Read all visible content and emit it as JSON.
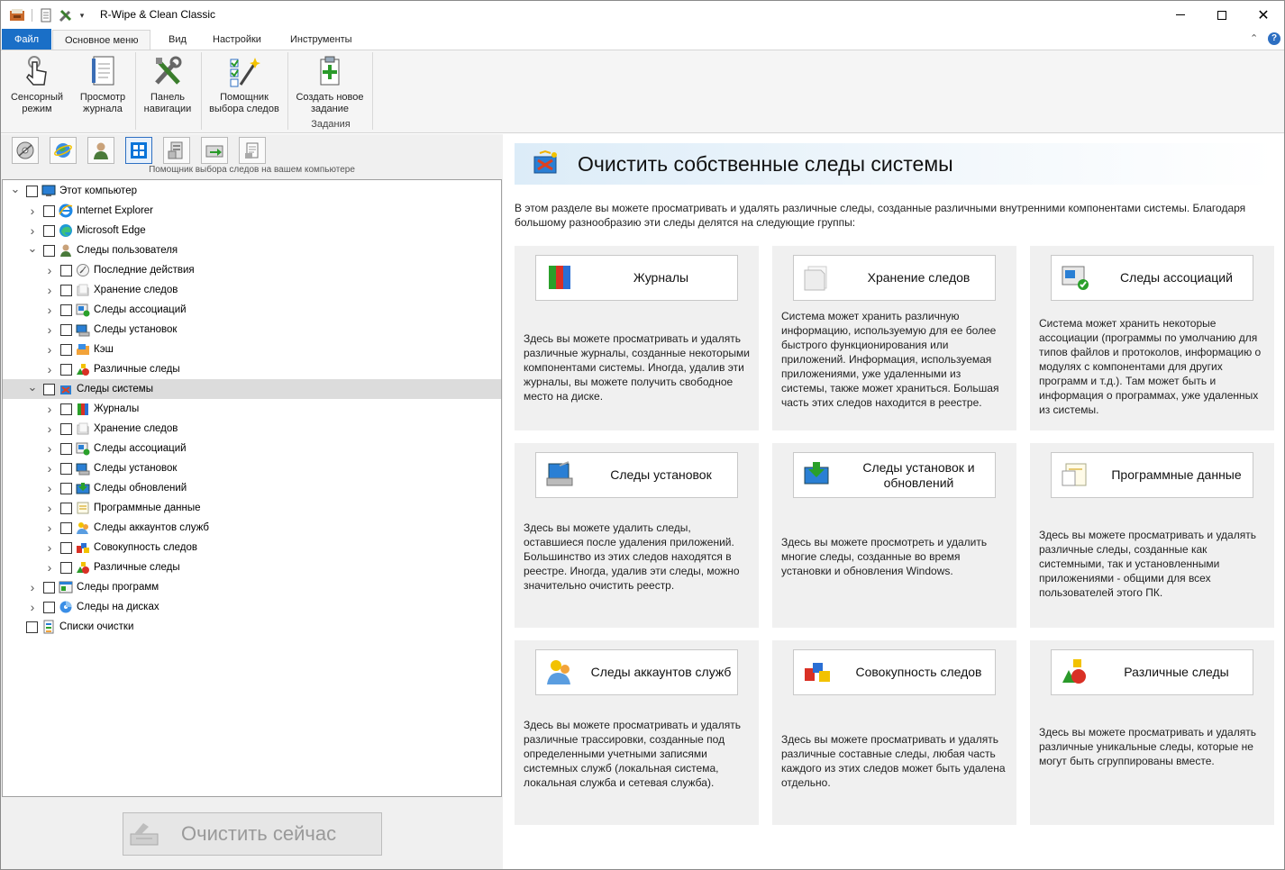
{
  "window": {
    "title": "R-Wipe & Clean Classic"
  },
  "ribbon": {
    "tabs": [
      "Файл",
      "Основное меню",
      "Вид",
      "Настройки",
      "Инструменты"
    ],
    "buttons": [
      {
        "line1": "Сенсорный",
        "line2": "режим",
        "icon": "touch-icon"
      },
      {
        "line1": "Просмотр",
        "line2": "журнала",
        "icon": "log-icon"
      },
      {
        "line1": "Панель",
        "line2": "навигации",
        "icon": "tools-icon"
      },
      {
        "line1": "Помощник",
        "line2": "выбора следов",
        "icon": "wizard-icon"
      },
      {
        "line1": "Создать новое",
        "line2": "задание",
        "icon": "new-task-icon"
      }
    ],
    "group_label": "Задания"
  },
  "toolbar": {
    "label": "Помощник выбора следов на вашем компьютере"
  },
  "tree": {
    "nodes": [
      {
        "label": "Этот компьютер",
        "level": 0,
        "expander": "open"
      },
      {
        "label": "Internet  Explorer",
        "level": 1,
        "expander": "closed"
      },
      {
        "label": "Microsoft Edge",
        "level": 1,
        "expander": "closed"
      },
      {
        "label": "Следы пользователя",
        "level": 1,
        "expander": "open"
      },
      {
        "label": "Последние действия",
        "level": 2,
        "expander": "closed"
      },
      {
        "label": "Хранение следов",
        "level": 2,
        "expander": "closed"
      },
      {
        "label": "Следы ассоциаций",
        "level": 2,
        "expander": "closed"
      },
      {
        "label": "Следы установок",
        "level": 2,
        "expander": "closed"
      },
      {
        "label": "Кэш",
        "level": 2,
        "expander": "closed"
      },
      {
        "label": "Различные следы",
        "level": 2,
        "expander": "closed"
      },
      {
        "label": "Следы системы",
        "level": 1,
        "expander": "open",
        "selected": true
      },
      {
        "label": "Журналы",
        "level": 2,
        "expander": "closed"
      },
      {
        "label": "Хранение следов",
        "level": 2,
        "expander": "closed"
      },
      {
        "label": "Следы ассоциаций",
        "level": 2,
        "expander": "closed"
      },
      {
        "label": "Следы установок",
        "level": 2,
        "expander": "closed"
      },
      {
        "label": "Следы обновлений",
        "level": 2,
        "expander": "closed"
      },
      {
        "label": "Программные данные",
        "level": 2,
        "expander": "closed"
      },
      {
        "label": "Следы аккаунтов служб",
        "level": 2,
        "expander": "closed"
      },
      {
        "label": "Совокупность следов",
        "level": 2,
        "expander": "closed"
      },
      {
        "label": "Различные следы",
        "level": 2,
        "expander": "closed"
      },
      {
        "label": "Следы программ",
        "level": 1,
        "expander": "closed"
      },
      {
        "label": "Следы на дисках",
        "level": 1,
        "expander": "closed"
      },
      {
        "label": "Списки очистки",
        "level": 0,
        "expander": "none"
      }
    ]
  },
  "clean_button": {
    "label": "Очистить сейчас"
  },
  "main": {
    "title": "Очистить собственные следы системы",
    "intro": "В этом разделе вы можете просматривать и удалять различные следы, созданные различными внутренними компонентами системы. Благодаря большому разнообразию эти следы делятся на следующие группы:",
    "cards": [
      {
        "title": "Журналы",
        "desc": "Здесь вы можете просматривать и удалять различные журналы, созданные некоторыми компонентами системы. Иногда, удалив эти журналы, вы можете получить свободное место на диске."
      },
      {
        "title": "Хранение следов",
        "desc": "Система может хранить различную информацию, используемую для ее более быстрого функционирования или приложений. Информация, используемая приложениями, уже удаленными из системы, также может храниться. Большая часть этих следов находится в реестре."
      },
      {
        "title": "Следы ассоциаций",
        "desc": "Система может хранить некоторые ассоциации (программы по умолчанию для типов файлов и протоколов, информацию о модулях с компонентами для других программ и т.д.). Там может быть и информация о программах, уже удаленных из системы."
      },
      {
        "title": "Следы установок",
        "desc": "Здесь вы можете удалить следы, оставшиеся после удаления приложений. Большинство из этих следов находятся в реестре. Иногда, удалив эти следы, можно значительно очистить реестр."
      },
      {
        "title": "Следы установок и обновлений",
        "desc": "Здесь вы можете просмотреть и удалить многие следы, созданные во время установки и обновления Windows."
      },
      {
        "title": "Программные данные",
        "desc": "Здесь вы можете просматривать и удалять различные следы, созданные как системными, так и установленными приложениями - общими для всех пользователей этого ПК."
      },
      {
        "title": "Следы аккаунтов служб",
        "desc": "Здесь вы можете просматривать и удалять различные трассировки, созданные под определенными учетными записями системных служб (локальная система, локальная служба и сетевая служба)."
      },
      {
        "title": "Совокупность следов",
        "desc": "Здесь вы можете просматривать и удалять различные составные следы, любая часть каждого из этих следов может быть удалена отдельно."
      },
      {
        "title": "Различные следы",
        "desc": "Здесь вы можете просматривать и удалять различные уникальные следы, которые не могут быть сгруппированы вместе."
      }
    ]
  }
}
